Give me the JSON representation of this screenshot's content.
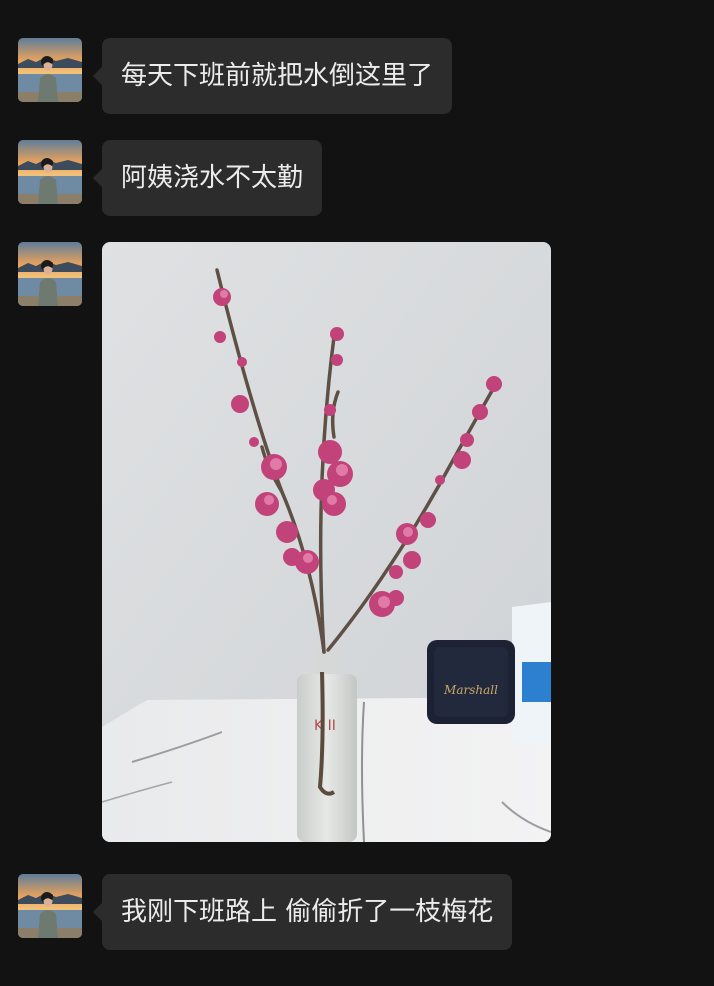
{
  "messages": [
    {
      "type": "text",
      "text": "每天下班前就把水倒这里了"
    },
    {
      "type": "text",
      "text": "阿姨浇水不太勤"
    },
    {
      "type": "image",
      "brand_label": "Marshall",
      "bottle_label": "K II"
    },
    {
      "type": "text",
      "text": "我刚下班路上 偷偷折了一枝梅花"
    }
  ],
  "colors": {
    "background": "#121212",
    "bubble": "#2c2c2c",
    "text": "#ececec"
  }
}
